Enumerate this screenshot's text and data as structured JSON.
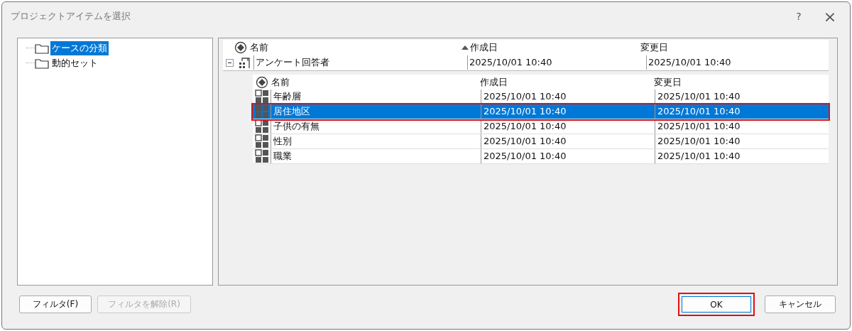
{
  "window": {
    "title": "プロジェクトアイテムを選択",
    "help": "?",
    "close": "×"
  },
  "tree": [
    {
      "label": "ケースの分類",
      "selected": true
    },
    {
      "label": "動的セット",
      "selected": false
    }
  ],
  "grid": {
    "columns": [
      {
        "label": "名前",
        "sorted": false
      },
      {
        "label": "作成日",
        "sorted": true
      },
      {
        "label": "変更日",
        "sorted": false
      }
    ],
    "row": {
      "name": "アンケート回答者",
      "created": "2025/10/01 10:40",
      "modified": "2025/10/01 10:40",
      "expanded": true,
      "detail": {
        "columns": [
          "名前",
          "作成日",
          "変更日"
        ],
        "rows": [
          {
            "name": "年齢層",
            "created": "2025/10/01 10:40",
            "modified": "2025/10/01 10:40",
            "selected": false,
            "highlighted": false
          },
          {
            "name": "居住地区",
            "created": "2025/10/01 10:40",
            "modified": "2025/10/01 10:40",
            "selected": true,
            "highlighted": true
          },
          {
            "name": "子供の有無",
            "created": "2025/10/01 10:40",
            "modified": "2025/10/01 10:40",
            "selected": false,
            "highlighted": false
          },
          {
            "name": "性別",
            "created": "2025/10/01 10:40",
            "modified": "2025/10/01 10:40",
            "selected": false,
            "highlighted": false
          },
          {
            "name": "職業",
            "created": "2025/10/01 10:40",
            "modified": "2025/10/01 10:40",
            "selected": false,
            "highlighted": false
          }
        ]
      }
    }
  },
  "buttons_left": [
    {
      "label": "フィルタ(F)",
      "disabled": false
    },
    {
      "label": "フィルタを解除(R)",
      "disabled": true
    }
  ],
  "buttons_right": [
    {
      "label": "OK",
      "highlighted": true,
      "disabled": false
    },
    {
      "label": "キャンセル",
      "highlighted": false,
      "disabled": false
    }
  ]
}
